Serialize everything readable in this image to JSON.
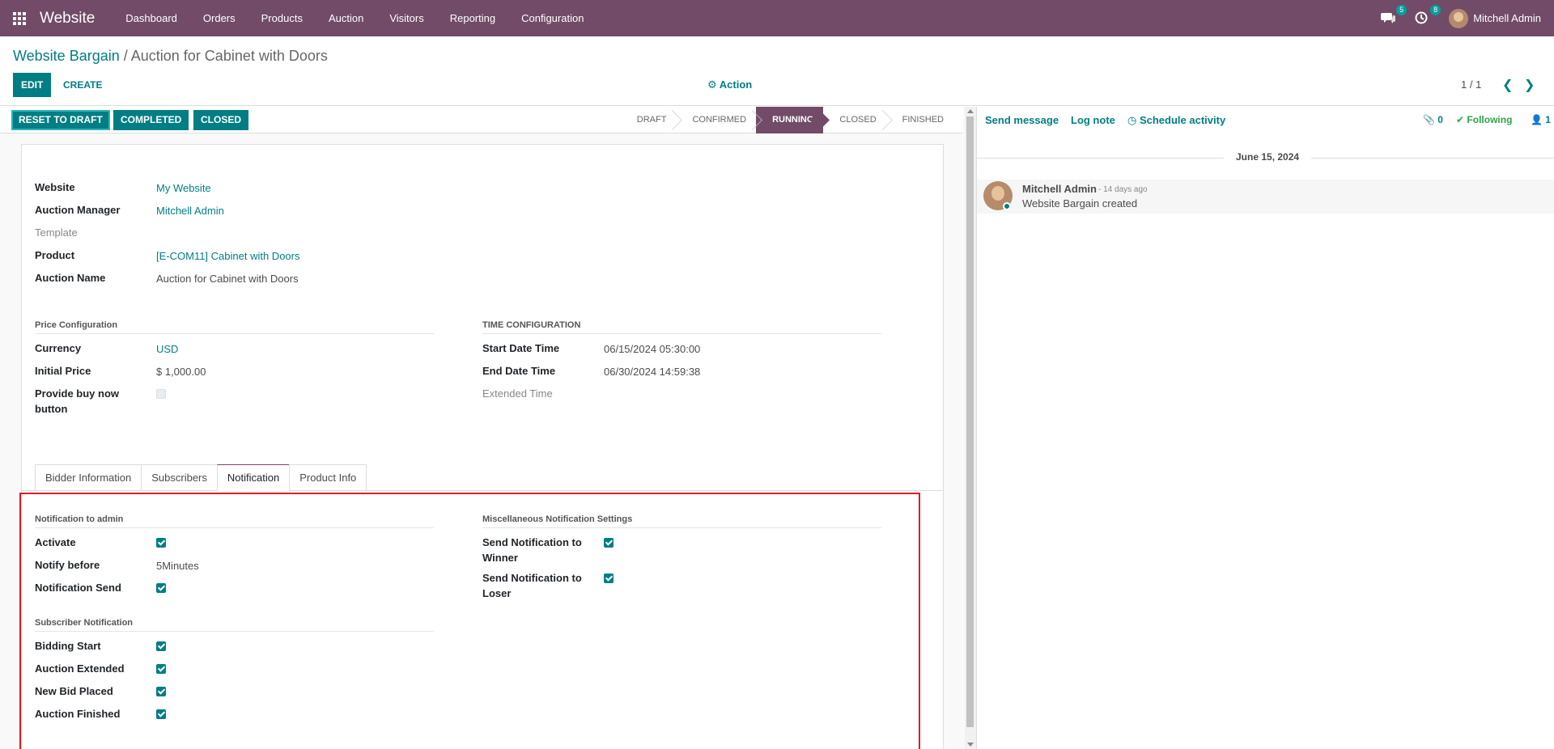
{
  "navbar": {
    "brand": "Website",
    "menu": [
      "Dashboard",
      "Orders",
      "Products",
      "Auction",
      "Visitors",
      "Reporting",
      "Configuration"
    ],
    "messages_badge": "5",
    "activities_badge": "8",
    "user_name": "Mitchell Admin"
  },
  "control": {
    "breadcrumb_parent": "Website Bargain",
    "breadcrumb_sep": " / ",
    "breadcrumb_current": "Auction for Cabinet with Doors",
    "edit_label": "EDIT",
    "create_label": "CREATE",
    "action_label": "⚙ Action",
    "pager": "1 / 1"
  },
  "statusbar": {
    "buttons": [
      "RESET TO DRAFT",
      "COMPLETED",
      "CLOSED"
    ],
    "stages": [
      "DRAFT",
      "CONFIRMED",
      "RUNNING",
      "CLOSED",
      "FINISHED"
    ],
    "active_stage": "RUNNING"
  },
  "form": {
    "website_label": "Website",
    "website_value": "My Website",
    "manager_label": "Auction Manager",
    "manager_value": "Mitchell Admin",
    "template_label": "Template",
    "product_label": "Product",
    "product_value": "[E-COM11] Cabinet with Doors",
    "name_label": "Auction Name",
    "name_value": "Auction for Cabinet with Doors",
    "price_section": "Price Configuration",
    "currency_label": "Currency",
    "currency_value": "USD",
    "initial_price_label": "Initial Price",
    "initial_price_value": "$ 1,000.00",
    "buy_now_label_1": "Provide buy now",
    "buy_now_label_2": "button",
    "time_section": "TIME CONFIGURATION",
    "start_label": "Start Date Time",
    "start_value": "06/15/2024 05:30:00",
    "end_label": "End Date Time",
    "end_value": "06/30/2024 14:59:38",
    "extended_label": "Extended Time"
  },
  "tabs": [
    "Bidder Information",
    "Subscribers",
    "Notification",
    "Product Info"
  ],
  "notification": {
    "admin_section": "Notification to admin",
    "activate_label": "Activate",
    "notify_before_label": "Notify before",
    "notify_before_value": "5Minutes",
    "notification_send_label": "Notification Send",
    "subscriber_section": "Subscriber Notification",
    "bidding_start_label": "Bidding Start",
    "auction_extended_label": "Auction Extended",
    "new_bid_label": "New Bid Placed",
    "auction_finished_label": "Auction Finished",
    "misc_section": "Miscellaneous Notification Settings",
    "winner_label_1": "Send Notification to",
    "winner_label_2": "Winner",
    "loser_label_1": "Send Notification to",
    "loser_label_2": "Loser"
  },
  "chatter": {
    "send_message": "Send message",
    "log_note": "Log note",
    "schedule_activity": "Schedule activity",
    "attachments": "0",
    "following": "Following",
    "followers": "1",
    "date": "June 15, 2024",
    "author": "Mitchell Admin",
    "ago": "- 14 days ago",
    "body": "Website Bargain created"
  },
  "colors": {
    "navbar": "#714b67",
    "primary": "#017e84",
    "highlight": "#e01b24",
    "following": "#28a745"
  }
}
